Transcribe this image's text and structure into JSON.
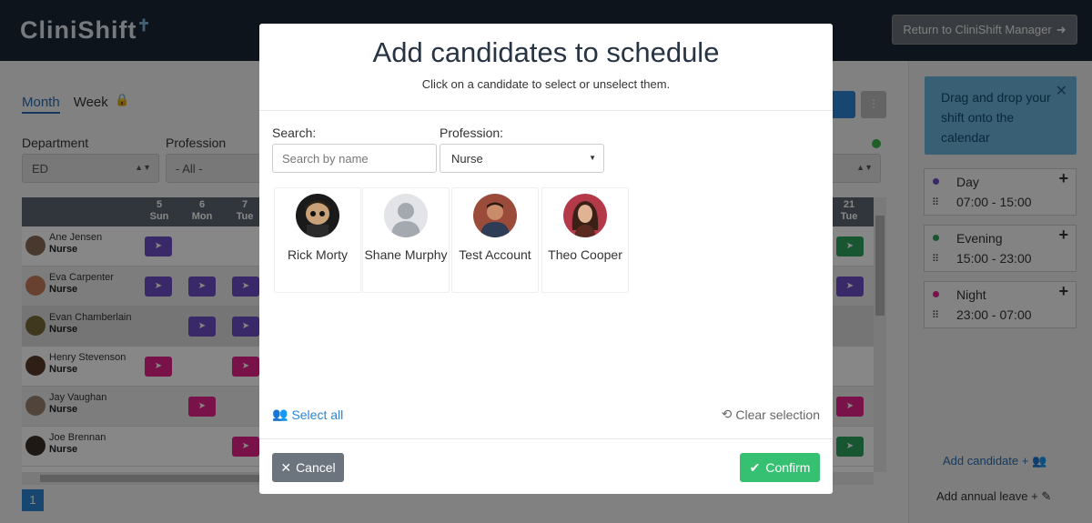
{
  "app": {
    "logo": "CliniShift",
    "return_label": "Return to CliniShift Manager"
  },
  "calendar": {
    "tabs": [
      "Month",
      "Week"
    ],
    "active_tab": "Month",
    "filters": {
      "department_label": "Department",
      "department_value": "ED",
      "profession_label": "Profession",
      "profession_value": "- All -"
    },
    "days": [
      {
        "num": "5",
        "dow": "Sun"
      },
      {
        "num": "6",
        "dow": "Mon"
      },
      {
        "num": "7",
        "dow": "Tue"
      },
      {
        "num": "21",
        "dow": "Tue"
      }
    ],
    "staff": [
      {
        "name": "Ane Jensen",
        "role": "Nurse"
      },
      {
        "name": "Eva Carpenter",
        "role": "Nurse"
      },
      {
        "name": "Evan Chamberlain",
        "role": "Nurse"
      },
      {
        "name": "Henry Stevenson",
        "role": "Nurse"
      },
      {
        "name": "Jay Vaughan",
        "role": "Nurse"
      },
      {
        "name": "Joe Brennan",
        "role": "Nurse"
      }
    ],
    "page": "1"
  },
  "sidebar": {
    "drag_hint": "Drag and drop your shift onto the calendar",
    "shifts": [
      {
        "name": "Day",
        "time": "07:00 - 15:00",
        "color": "#6c4fc4"
      },
      {
        "name": "Evening",
        "time": "15:00 - 23:00",
        "color": "#2fa05d"
      },
      {
        "name": "Night",
        "time": "23:00 - 07:00",
        "color": "#e2228a"
      }
    ],
    "add_candidate": "Add candidate +",
    "add_leave": "Add annual leave +"
  },
  "modal": {
    "title": "Add candidates to schedule",
    "subtitle": "Click on a candidate to select or unselect them.",
    "search_label": "Search:",
    "search_placeholder": "Search by name",
    "profession_label": "Profession:",
    "profession_value": "Nurse",
    "candidates": [
      {
        "name": "Rick Morty"
      },
      {
        "name": "Shane Murphy"
      },
      {
        "name": "Test Account"
      },
      {
        "name": "Theo Cooper"
      }
    ],
    "select_all": "Select all",
    "clear_selection": "Clear selection",
    "cancel": "Cancel",
    "confirm": "Confirm"
  }
}
